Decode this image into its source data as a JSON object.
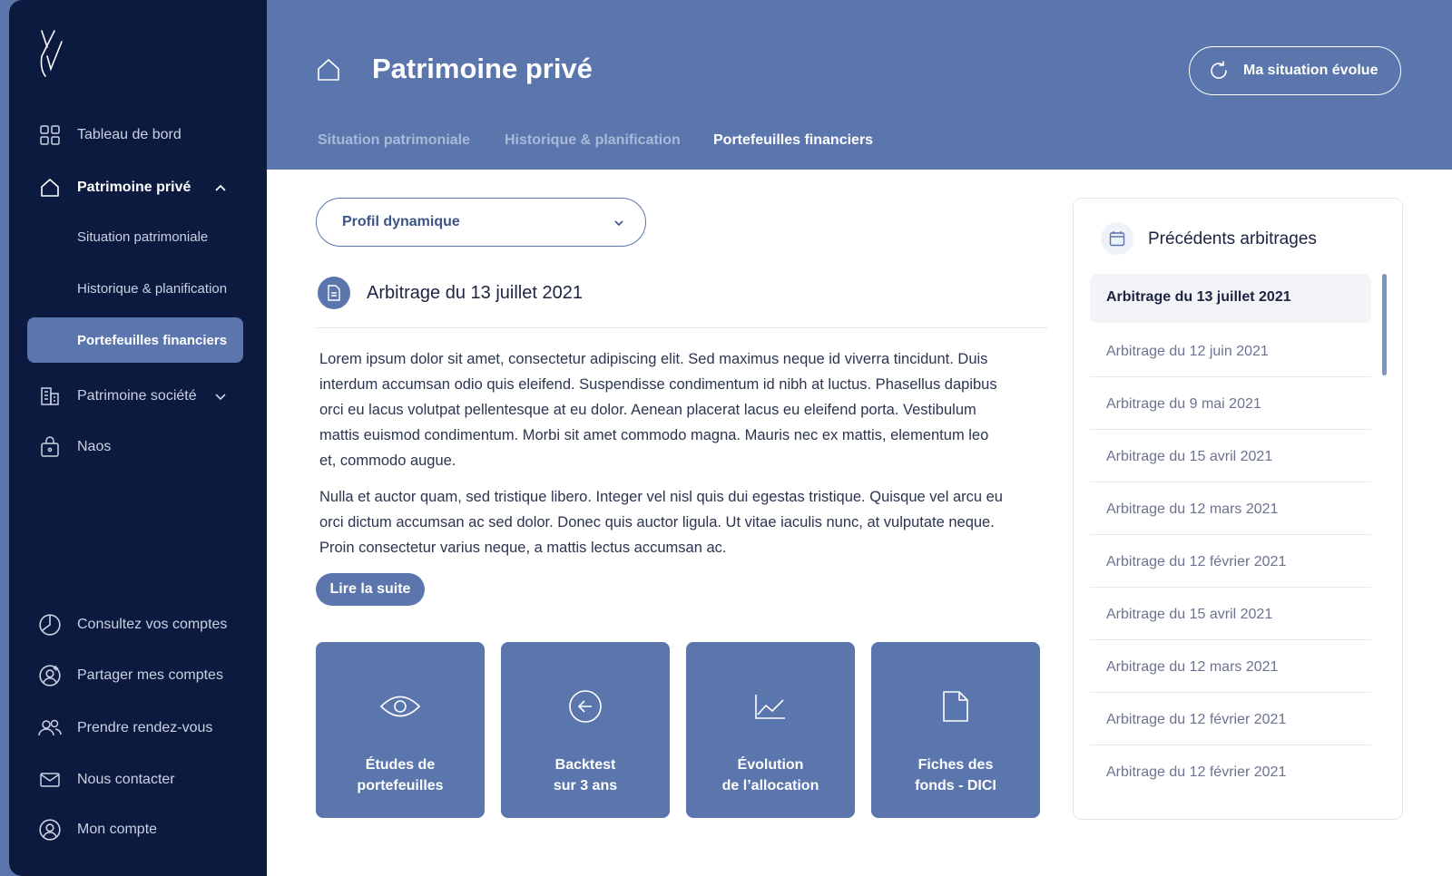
{
  "colors": {
    "sidebar": "#0c1a3f",
    "accent": "#5a76ad",
    "white": "#ffffff",
    "text": "#1b2440"
  },
  "sidebar": {
    "items": [
      {
        "label": "Tableau de bord",
        "icon": "grid-icon"
      },
      {
        "label": "Patrimoine privé",
        "icon": "home-icon"
      },
      {
        "label": "Patrimoine société",
        "icon": "building-icon"
      },
      {
        "label": "Naos",
        "icon": "lock-bag-icon"
      }
    ],
    "sub_items": [
      {
        "label": "Situation patrimoniale"
      },
      {
        "label": "Historique & planification"
      },
      {
        "label": "Portefeuilles financiers"
      }
    ],
    "bottom_items": [
      {
        "label": "Consultez vos comptes",
        "icon": "pie-chart-icon"
      },
      {
        "label": "Partager mes comptes",
        "icon": "user-plus-icon"
      },
      {
        "label": "Prendre rendez-vous",
        "icon": "users-icon"
      },
      {
        "label": "Nous contacter",
        "icon": "mail-icon"
      },
      {
        "label": "Mon compte",
        "icon": "user-circle-icon"
      }
    ]
  },
  "header": {
    "title": "Patrimoine privé",
    "action_label": "Ma situation évolue",
    "tabs": [
      {
        "label": "Situation patrimoniale"
      },
      {
        "label": "Historique & planification"
      },
      {
        "label": "Portefeuilles financiers"
      }
    ]
  },
  "main": {
    "profile_select": "Profil dynamique",
    "arbitrage_title": "Arbitrage du 13 juillet 2021",
    "paragraph_1": "Lorem ipsum dolor sit amet, consectetur adipiscing elit. Sed maximus neque id viverra tincidunt. Duis interdum accumsan odio quis eleifend. Suspendisse condimentum id nibh at luctus. Phasellus dapibus orci eu lacus volutpat pellentesque at eu dolor. Aenean placerat lacus eu eleifend porta. Vestibulum mattis euismod condimentum. Morbi sit amet commodo magna. Mauris nec ex mattis, elementum leo et, commodo augue.",
    "paragraph_2": "Nulla et auctor quam, sed tristique libero. Integer vel nisl quis dui egestas tristique. Quisque vel arcu eu orci dictum accumsan ac sed dolor. Donec quis auctor ligula. Ut vitae iaculis nunc, at vulputate neque. Proin consectetur varius neque, a mattis lectus accumsan ac.",
    "read_more": "Lire la suite",
    "cards": [
      {
        "label": "Études de\nportefeuilles",
        "icon": "eye-icon"
      },
      {
        "label": "Backtest\nsur 3 ans",
        "icon": "arrow-left-circle-icon"
      },
      {
        "label": "Évolution\nde l’allocation",
        "icon": "line-chart-icon"
      },
      {
        "label": "Fiches des\nfonds - DICI",
        "icon": "file-icon"
      }
    ]
  },
  "history": {
    "title": "Précédents arbitrages",
    "items": [
      "Arbitrage du 13 juillet 2021",
      "Arbitrage du 12 juin 2021",
      "Arbitrage du 9 mai 2021",
      "Arbitrage du 15 avril 2021",
      "Arbitrage du 12 mars 2021",
      "Arbitrage du 12 février 2021",
      "Arbitrage du 15 avril 2021",
      "Arbitrage du 12 mars 2021",
      "Arbitrage du 12 février 2021",
      "Arbitrage du 12 février 2021"
    ]
  }
}
